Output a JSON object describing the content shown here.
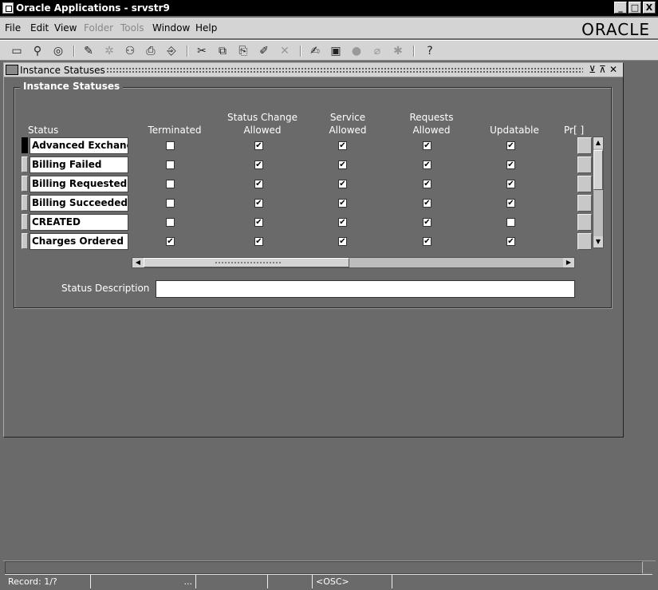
{
  "window": {
    "title": "Oracle Applications - srvstr9",
    "btn_min": "_",
    "btn_max": "□",
    "btn_close": "X"
  },
  "menubar": {
    "items": [
      "File",
      "Edit",
      "View",
      "Folder",
      "Tools",
      "Window",
      "Help"
    ],
    "logo": "ORACLE"
  },
  "form": {
    "title": "Instance Statuses",
    "frame_label": "Instance Statuses",
    "columns": {
      "status": "Status",
      "terminated": "Terminated",
      "status_change": [
        "Status Change",
        "Allowed"
      ],
      "service": [
        "Service",
        "Allowed"
      ],
      "requests": [
        "Requests",
        "Allowed"
      ],
      "updatable": "Updatable",
      "pr": "Pr[ ]"
    },
    "rows": [
      {
        "status": "Advanced Exchang",
        "terminated": false,
        "status_change": true,
        "service": true,
        "requests": true,
        "updatable": true
      },
      {
        "status": "Billing Failed",
        "terminated": false,
        "status_change": true,
        "service": true,
        "requests": true,
        "updatable": true
      },
      {
        "status": "Billing Requested",
        "terminated": false,
        "status_change": true,
        "service": true,
        "requests": true,
        "updatable": true
      },
      {
        "status": "Billing Succeeded",
        "terminated": false,
        "status_change": true,
        "service": true,
        "requests": true,
        "updatable": true
      },
      {
        "status": "CREATED",
        "terminated": false,
        "status_change": true,
        "service": true,
        "requests": true,
        "updatable": false
      },
      {
        "status": "Charges Ordered",
        "terminated": true,
        "status_change": true,
        "service": true,
        "requests": true,
        "updatable": true
      }
    ],
    "status_description_label": "Status Description",
    "status_description_value": ""
  },
  "statusbar": {
    "record": "Record: 1/?",
    "ellipsis": "...",
    "osc": "<OSC>"
  }
}
